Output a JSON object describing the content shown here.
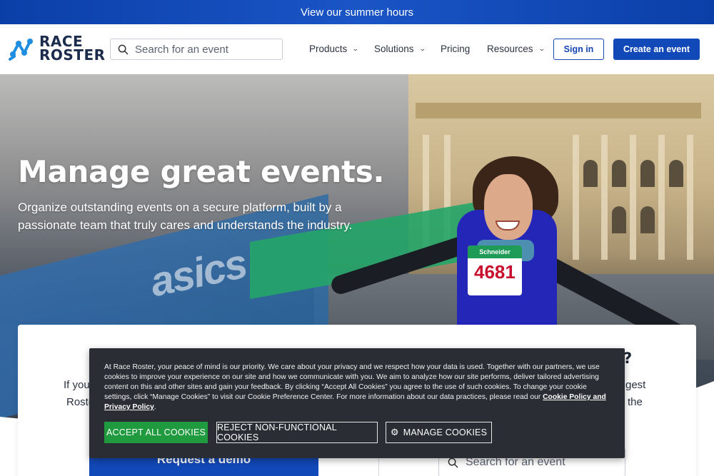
{
  "banner": {
    "text": "View our summer hours"
  },
  "header": {
    "logo": {
      "line1": "RACE",
      "line2": "ROSTER"
    },
    "search_placeholder": "Search for an event",
    "nav": [
      {
        "label": "Products",
        "has_dropdown": true
      },
      {
        "label": "Solutions",
        "has_dropdown": true
      },
      {
        "label": "Pricing",
        "has_dropdown": false
      },
      {
        "label": "Resources",
        "has_dropdown": true
      }
    ],
    "sign_in": "Sign in",
    "create_event": "Create an event"
  },
  "hero": {
    "title": "Manage great events.",
    "subtitle": "Organize outstanding events on a secure platform, built by a passionate team that truly cares and understands the industry.",
    "bib": {
      "brand": "Schneider",
      "number": "4681"
    },
    "board_text": "asics"
  },
  "card": {
    "heading_tail": "nt?",
    "left_line1": "If you'",
    "left_line2": "Roste",
    "right_line1": "gest",
    "right_line2": "the",
    "demo_button": "Request a demo",
    "search_placeholder": "Search for an event"
  },
  "cookie_banner": {
    "text": "At Race Roster, your peace of mind is our priority. We care about your privacy and we respect how your data is used. Together with our partners, we use cookies to improve your experience on our site and how we communicate with you. We aim to analyze how our site performs, deliver tailored advertising content on this and other sites and gain your feedback. By clicking “Accept All Cookies” you agree to the use of such cookies. To change your cookie settings, click “Manage Cookies” to visit our Cookie Preference Center. For more information about our data practices, please read our ",
    "link": "Cookie Policy and Privacy Policy",
    "text_end": ".",
    "accept": "ACCEPT ALL COOKIES",
    "reject": "REJECT NON-FUNCTIONAL COOKIES",
    "manage": "MANAGE COOKIES"
  },
  "colors": {
    "brand_blue": "#1249b8",
    "banner_blue": "#0b3fa8",
    "accept_green": "#1f9a3e",
    "cookie_bg": "#2a2d33",
    "logo_blue": "#1f8de0"
  },
  "icons": [
    "race-roster-logo-icon",
    "search-icon",
    "chevron-down-icon",
    "gear-icon"
  ]
}
